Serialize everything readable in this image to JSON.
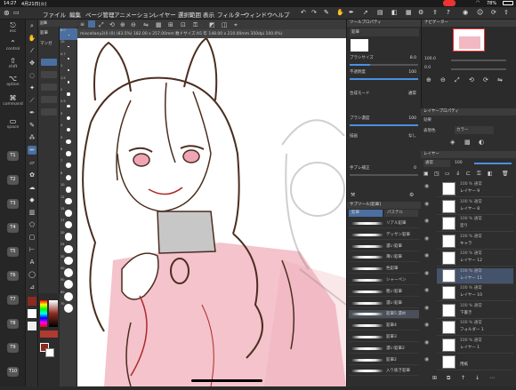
{
  "status": {
    "time": "14:27",
    "date": "4月21日(火)",
    "battery": "78%"
  },
  "menu": {
    "items": [
      "ファイル",
      "編集",
      "ページ管理",
      "アニメーション",
      "レイヤー",
      "選択範囲",
      "表示",
      "フィルター",
      "ウィンドウ",
      "ヘルプ"
    ]
  },
  "left": {
    "labels": [
      "esc",
      "control",
      "shift",
      "option",
      "command",
      "space",
      "T1",
      "T2",
      "T3",
      "T4",
      "T5",
      "T6",
      "T7",
      "T8",
      "T9",
      "T10"
    ]
  },
  "tools": {
    "icons": [
      "zoom-icon",
      "hand-icon",
      "eyedropper-icon",
      "pen-icon",
      "move-icon",
      "lasso-icon",
      "magic-wand-icon",
      "eraser-icon",
      "brush-icon",
      "pencil-icon",
      "airbrush-icon",
      "decoration-icon",
      "blend-icon",
      "fill-icon",
      "gradient-icon",
      "figure-icon",
      "frame-icon",
      "ruler-icon",
      "text-icon",
      "balloon-icon"
    ]
  },
  "subtool": {
    "tabs": [
      "鉛筆",
      "マンガ"
    ],
    "items": [
      "鉛筆",
      "シャープ",
      "ペン",
      "マーカー",
      "色鉛筆"
    ]
  },
  "brushsizes": [
    "8.0",
    "10",
    "0.7",
    "1",
    "1.5",
    "2",
    "2.5",
    "3",
    "4",
    "5",
    "6",
    "7",
    "8",
    "10",
    "12",
    "15",
    "17",
    "20",
    "25",
    "30",
    "40",
    "50",
    "60",
    "70"
  ],
  "canvas": {
    "tab": "miscellany2(0 (0) (83.5%) 182.00 x 257.00mm 数ドサイズ:A5 年 148.00 x 210.00mm 350dpi 100.0%)"
  },
  "props": {
    "title": "ツールプロパティ",
    "tool": "鉛筆",
    "rows": [
      {
        "label": "ブラシサイズ",
        "value": "8.0"
      },
      {
        "label": "不透明度",
        "value": "100"
      },
      {
        "label": "合成モード",
        "value": "通常"
      },
      {
        "label": "ブラシ濃度",
        "value": "100"
      },
      {
        "label": "描画",
        "value": "なし"
      },
      {
        "label": "手ブレ補正",
        "value": "0"
      }
    ]
  },
  "brushes": {
    "title": "サブツール[鉛筆]",
    "tabs": [
      "鉛筆",
      "パステル"
    ],
    "items": [
      "リアル鉛筆",
      "デッサン鉛筆",
      "濃い鉛筆",
      "薄い鉛筆",
      "色鉛筆",
      "シャーペン",
      "粗い鉛筆",
      "濃い鉛筆",
      "鉛筆5 濃め",
      "鉛筆4",
      "鉛筆3",
      "濃い鉛筆2",
      "鉛筆2",
      "入り抜き鉛筆"
    ],
    "selected_index": 8
  },
  "navigator": {
    "title": "ナビゲーター",
    "zoom": "100.0",
    "angle": "0.0"
  },
  "layerprop": {
    "title": "レイヤープロパティ",
    "effect": "効果",
    "color_label": "表現色",
    "color_value": "カラー"
  },
  "layers": {
    "title": "レイヤー",
    "blend": "通常",
    "opacity": "100",
    "rows": [
      {
        "mode": "100 % 通常",
        "name": "レイヤー 9",
        "sel": false
      },
      {
        "mode": "100 % 通常",
        "name": "レイヤー 8",
        "sel": false
      },
      {
        "mode": "100 % 通常",
        "name": "塗り",
        "sel": false
      },
      {
        "mode": "100 % 通常",
        "name": "キャラ",
        "sel": false
      },
      {
        "mode": "100 % 通常",
        "name": "レイヤー 12",
        "sel": false
      },
      {
        "mode": "100 % 通常",
        "name": "レイヤー 11",
        "sel": true
      },
      {
        "mode": "100 % 通常",
        "name": "レイヤー 10",
        "sel": false
      },
      {
        "mode": "100 % 通常",
        "name": "下書き",
        "sel": false
      },
      {
        "mode": "100 % 通常",
        "name": "フォルダー 1",
        "sel": false
      },
      {
        "mode": "100 % 通常",
        "name": "レイヤー 1",
        "sel": false
      },
      {
        "mode": "",
        "name": "用紙",
        "sel": false
      }
    ]
  },
  "colors": {
    "main": "#8b2a1e",
    "sub": "#ffffff",
    "accent": "#4a90e2",
    "line": "#4a2e1f",
    "pink": "#e8a0ac"
  }
}
